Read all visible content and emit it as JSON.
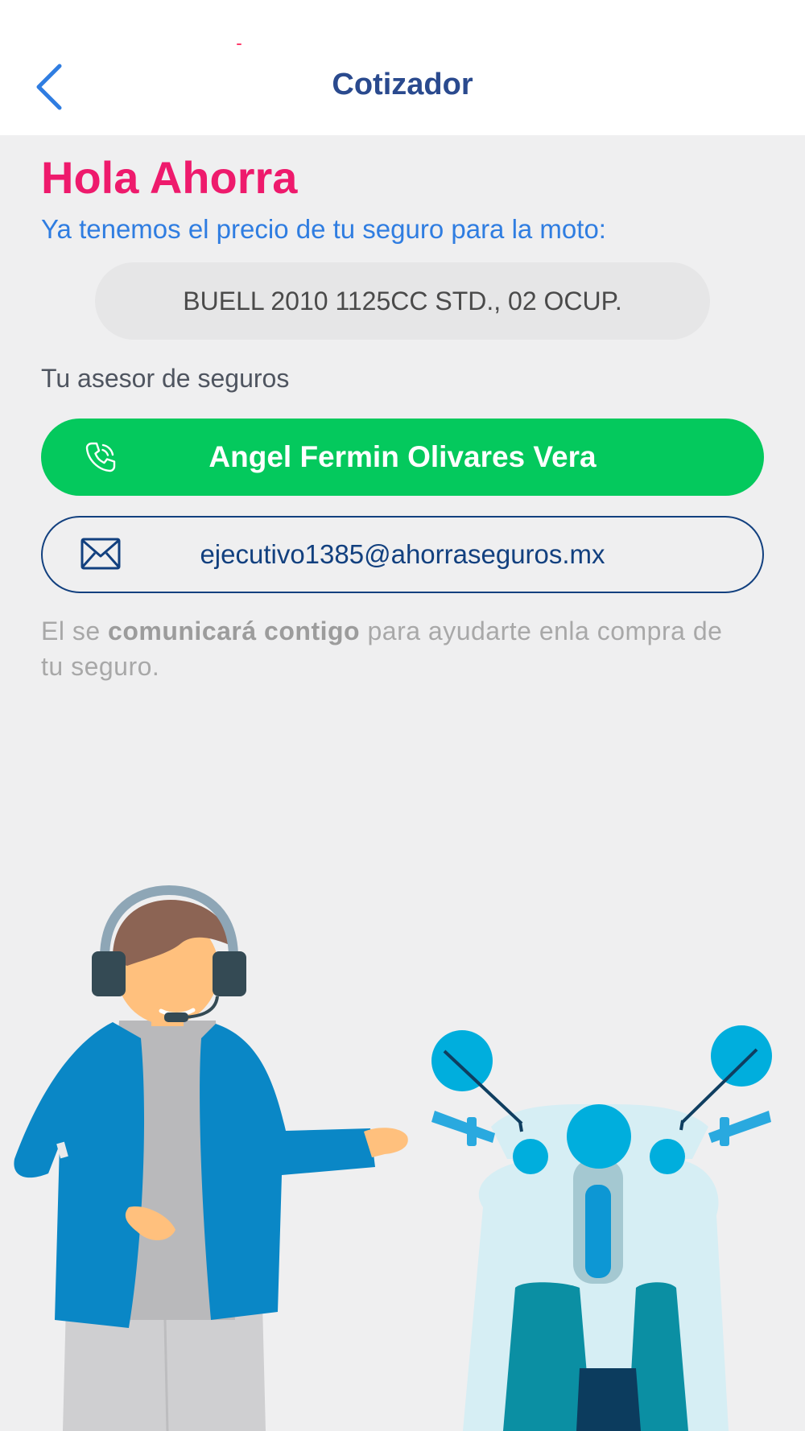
{
  "nav": {
    "back_icon": "chevron-left-icon",
    "title": "Cotizador"
  },
  "colors": {
    "accent_pink": "#ee1a6c",
    "link_blue": "#2f7de1",
    "call_green": "#04c95d",
    "navy": "#12407f"
  },
  "main": {
    "greeting": "Hola Ahorra",
    "subtitle": "Ya tenemos el precio de tu seguro para la moto:",
    "vehicle": "BUELL 2010 1125CC STD., 02 OCUP.",
    "advisor_label": "Tu asesor de seguros",
    "advisor_name": "Angel Fermin Olivares Vera",
    "advisor_email": "ejecutivo1385@ahorraseguros.mx",
    "note": {
      "part1": "El se ",
      "bold": "comunicará contigo",
      "part2": " para ayudarte enla compra de tu seguro."
    }
  },
  "icons": {
    "call": "phone-icon",
    "mail": "envelope-icon",
    "illustration": "agent-and-scooter-illustration"
  }
}
